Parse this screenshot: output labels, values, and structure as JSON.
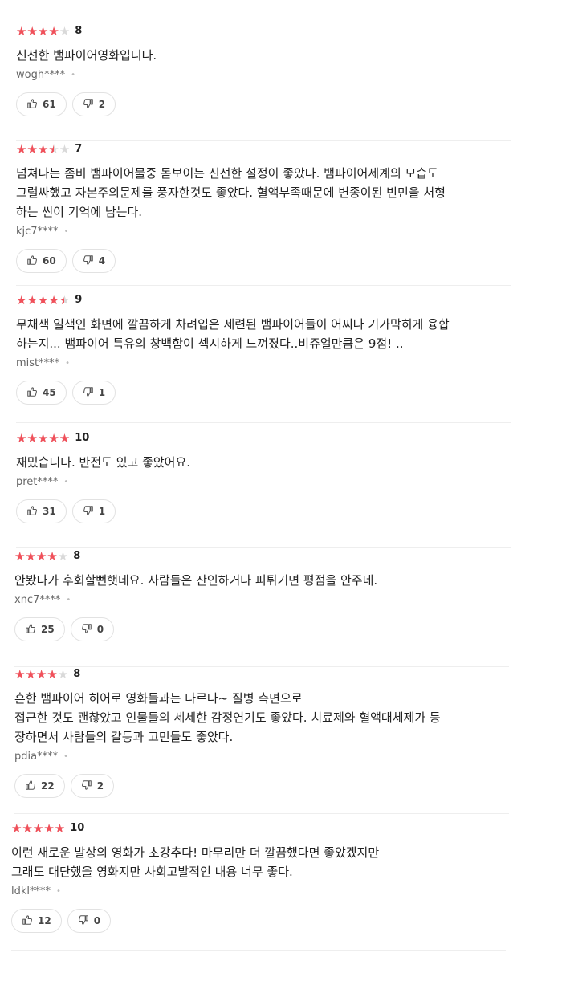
{
  "colors": {
    "star": "#f1505a",
    "star_empty": "#d9d9d9",
    "divider": "#eeeeee"
  },
  "reviews": [
    {
      "stars_fraction": 0.8,
      "score": "8",
      "text_lines": [
        "신선한 뱀파이어영화입니다."
      ],
      "author": "wogh****",
      "likes": "61",
      "dislikes": "2"
    },
    {
      "stars_fraction": 0.7,
      "score": "7",
      "text_lines": [
        "넘쳐나는 좀비 뱀파이어물중 돋보이는 신선한 설정이 좋았다. 뱀파이어세계의 모습도",
        "그럴싸했고 자본주의문제를 풍자한것도 좋았다. 혈액부족때문에 변종이된 빈민을 처형",
        "하는 씬이 기억에 남는다."
      ],
      "author": "kjc7****",
      "likes": "60",
      "dislikes": "4"
    },
    {
      "stars_fraction": 0.9,
      "score": "9",
      "text_lines": [
        "무채색 일색인 화면에 깔끔하게 차려입은 세련된 뱀파이어들이 어찌나 기가막히게 융합",
        "하는지... 뱀파이어 특유의 창백함이 섹시하게 느껴졌다..비쥬얼만큼은 9점! .."
      ],
      "author": "mist****",
      "likes": "45",
      "dislikes": "1"
    },
    {
      "stars_fraction": 1.0,
      "score": "10",
      "text_lines": [
        "재밌습니다. 반전도 있고 좋았어요."
      ],
      "author": "pret****",
      "likes": "31",
      "dislikes": "1"
    },
    {
      "stars_fraction": 0.8,
      "score": "8",
      "text_lines": [
        "안봤다가 후회할뻔햇네요. 사람들은 잔인하거나 피튀기면 평점을 안주네."
      ],
      "author": "xnc7****",
      "likes": "25",
      "dislikes": "0"
    },
    {
      "stars_fraction": 0.8,
      "score": "8",
      "text_lines": [
        "흔한 뱀파이어 히어로 영화들과는 다르다~ 질병 측면으로",
        "접근한 것도 괜찮았고 인물들의 세세한 감정연기도 좋았다. 치료제와 혈액대체제가 등",
        "장하면서 사람들의 갈등과 고민들도 좋았다."
      ],
      "author": "pdia****",
      "likes": "22",
      "dislikes": "2"
    },
    {
      "stars_fraction": 1.0,
      "score": "10",
      "text_lines": [
        "이런 새로운 발상의 영화가 초강추다! 마무리만 더 깔끔했다면 좋았겠지만",
        "그래도 대단했을 영화지만 사회고발적인 내용 너무 좋다."
      ],
      "author": "ldkl****",
      "likes": "12",
      "dislikes": "0"
    }
  ]
}
